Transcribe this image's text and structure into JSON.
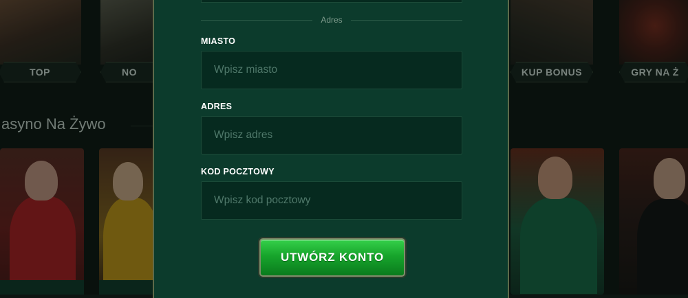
{
  "background": {
    "top_tiles": [
      {
        "label": "TOP"
      },
      {
        "label": "NO"
      },
      {
        "label": "KUP BONUS"
      },
      {
        "label": "GRY NA Ż"
      }
    ],
    "live_section_title": "asyno Na Żywo"
  },
  "modal": {
    "section_divider": "Adres",
    "fields": {
      "city": {
        "label": "MIASTO",
        "placeholder": "Wpisz miasto"
      },
      "address": {
        "label": "ADRES",
        "placeholder": "Wpisz adres"
      },
      "postal_code": {
        "label": "KOD POCZTOWY",
        "placeholder": "Wpisz kod pocztowy"
      }
    },
    "submit_label": "UTWÓRZ KONTO"
  },
  "colors": {
    "modal_bg": "#0c3b2c",
    "input_bg": "#062a1f",
    "button_green": "#17a52c",
    "border_gold": "#5e6a4a"
  }
}
